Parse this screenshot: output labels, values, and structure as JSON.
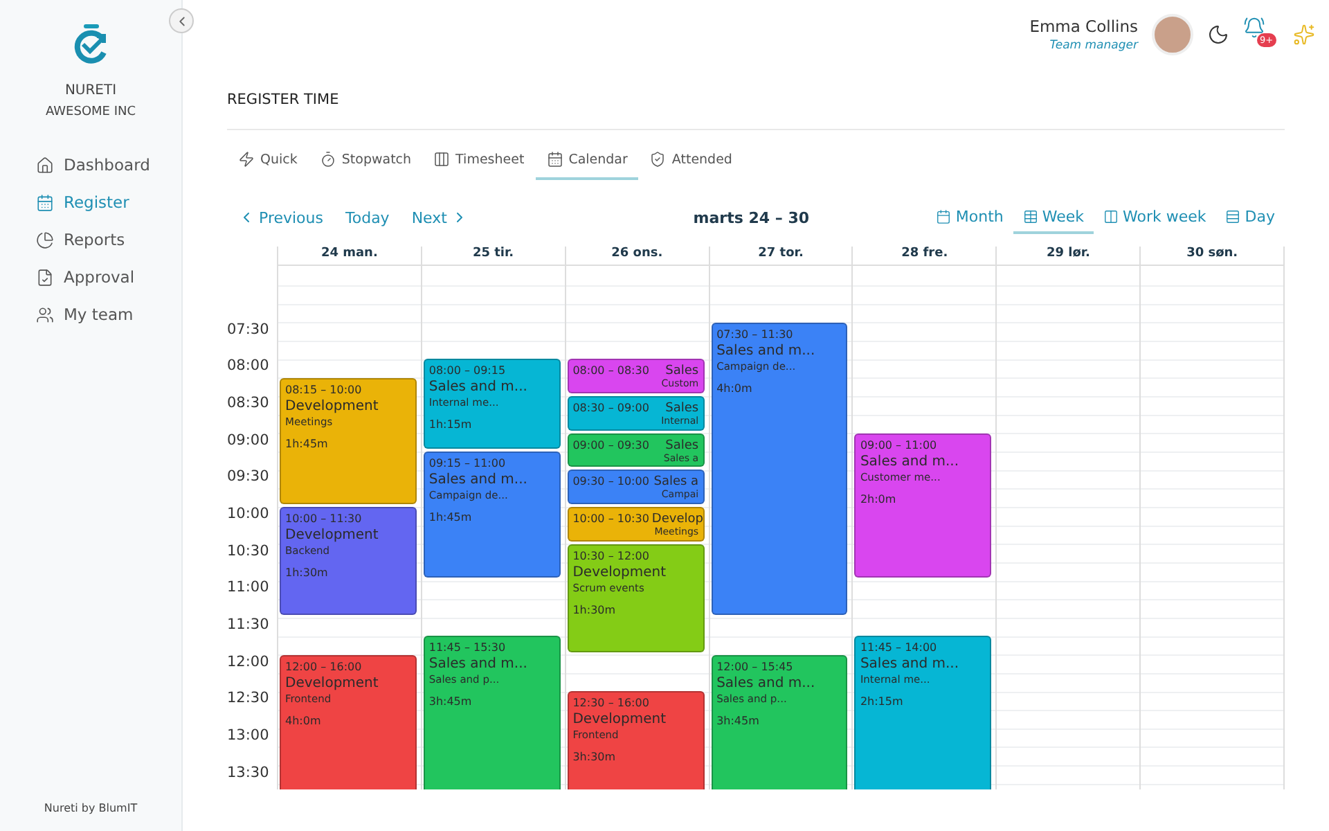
{
  "sidebar": {
    "brand": "NURETI",
    "company": "AWESOME INC",
    "items": [
      {
        "label": "Dashboard",
        "selected": false
      },
      {
        "label": "Register",
        "selected": true
      },
      {
        "label": "Reports",
        "selected": false
      },
      {
        "label": "Approval",
        "selected": false
      },
      {
        "label": "My team",
        "selected": false
      }
    ],
    "footer": "Nureti by BlumIT"
  },
  "user": {
    "name": "Emma Collins",
    "role": "Team manager",
    "notifications": "9+"
  },
  "page_title": "REGISTER TIME",
  "tabs": [
    {
      "label": "Quick",
      "selected": false
    },
    {
      "label": "Stopwatch",
      "selected": false
    },
    {
      "label": "Timesheet",
      "selected": false
    },
    {
      "label": "Calendar",
      "selected": true
    },
    {
      "label": "Attended",
      "selected": false
    }
  ],
  "nav": {
    "previous": "Previous",
    "today": "Today",
    "next": "Next",
    "range": "marts 24 – 30"
  },
  "views": [
    {
      "label": "Month",
      "selected": false
    },
    {
      "label": "Week",
      "selected": true
    },
    {
      "label": "Work week",
      "selected": false
    },
    {
      "label": "Day",
      "selected": false
    }
  ],
  "times": [
    "07:30",
    "08:00",
    "08:30",
    "09:00",
    "09:30",
    "10:00",
    "10:30",
    "11:00",
    "11:30",
    "12:00",
    "12:30",
    "13:00",
    "13:30"
  ],
  "days": [
    {
      "label": "24 man.",
      "events": [
        {
          "kind": "full",
          "time": "08:15 – 10:00",
          "title": "Development",
          "subtitle": "Meetings",
          "duration": "1h:45m",
          "color": "#eab308"
        },
        {
          "kind": "full",
          "time": "10:00 – 11:30",
          "title": "Development",
          "subtitle": "Backend",
          "duration": "1h:30m",
          "color": "#6366f1"
        },
        {
          "kind": "full",
          "time": "12:00 – 16:00",
          "title": "Development",
          "subtitle": "Frontend",
          "duration": "4h:0m",
          "color": "#ef4444"
        }
      ]
    },
    {
      "label": "25 tir.",
      "events": [
        {
          "kind": "full",
          "time": "08:00 – 09:15",
          "title": "Sales and m...",
          "subtitle": "Internal me...",
          "duration": "1h:15m",
          "color": "#06b6d4"
        },
        {
          "kind": "full",
          "time": "09:15 – 11:00",
          "title": "Sales and m...",
          "subtitle": "Campaign de...",
          "duration": "1h:45m",
          "color": "#3b82f6"
        },
        {
          "kind": "full",
          "time": "11:45 – 15:30",
          "title": "Sales and m...",
          "subtitle": "Sales and p...",
          "duration": "3h:45m",
          "color": "#22c55e"
        }
      ]
    },
    {
      "label": "26 ons.",
      "events": [
        {
          "kind": "compact",
          "time": "08:00 – 08:30",
          "title": "Sales",
          "subtitle": "Custom",
          "color": "#d946ef"
        },
        {
          "kind": "compact",
          "time": "08:30 – 09:00",
          "title": "Sales",
          "subtitle": "Internal",
          "color": "#06b6d4"
        },
        {
          "kind": "compact",
          "time": "09:00 – 09:30",
          "title": "Sales",
          "subtitle": "Sales a",
          "color": "#22c55e"
        },
        {
          "kind": "compact",
          "time": "09:30 – 10:00",
          "title": "Sales a",
          "subtitle": "Campai",
          "color": "#3b82f6"
        },
        {
          "kind": "compact",
          "time": "10:00 – 10:30",
          "title": "Develop",
          "subtitle": "Meetings",
          "color": "#eab308"
        },
        {
          "kind": "full",
          "time": "10:30 – 12:00",
          "title": "Development",
          "subtitle": "Scrum events",
          "duration": "1h:30m",
          "color": "#84cc16"
        },
        {
          "kind": "full",
          "time": "12:30 – 16:00",
          "title": "Development",
          "subtitle": "Frontend",
          "duration": "3h:30m",
          "color": "#ef4444"
        }
      ]
    },
    {
      "label": "27 tor.",
      "events": [
        {
          "kind": "full",
          "time": "07:30 – 11:30",
          "title": "Sales and m...",
          "subtitle": "Campaign de...",
          "duration": "4h:0m",
          "color": "#3b82f6"
        },
        {
          "kind": "full",
          "time": "12:00 – 15:45",
          "title": "Sales and m...",
          "subtitle": "Sales and p...",
          "duration": "3h:45m",
          "color": "#22c55e"
        }
      ]
    },
    {
      "label": "28 fre.",
      "events": [
        {
          "kind": "full",
          "time": "09:00 – 11:00",
          "title": "Sales and m...",
          "subtitle": "Customer me...",
          "duration": "2h:0m",
          "color": "#d946ef"
        },
        {
          "kind": "full",
          "time": "11:45 – 14:00",
          "title": "Sales and m...",
          "subtitle": "Internal me...",
          "duration": "2h:15m",
          "color": "#06b6d4"
        }
      ]
    },
    {
      "label": "29 lør."
    },
    {
      "label": "30 søn."
    }
  ]
}
